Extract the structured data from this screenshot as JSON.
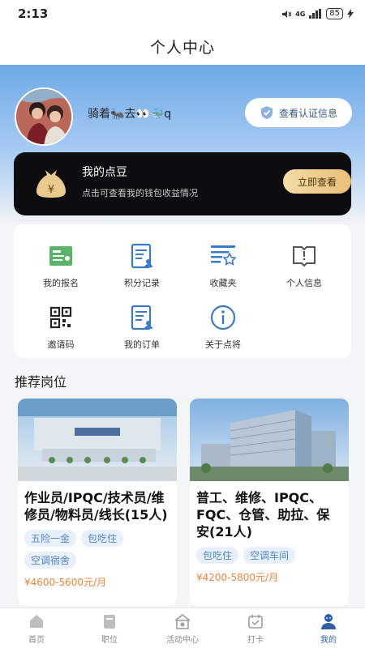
{
  "status": {
    "time": "2:13",
    "signal": "4G",
    "battery": "85"
  },
  "nav": {
    "title": "个人中心"
  },
  "profile": {
    "username": "骑着🐜去👀🐳q",
    "verify_label": "查看认证信息"
  },
  "coin_card": {
    "title": "我的点豆",
    "subtitle": "点击可查看我的钱包收益情况",
    "button": "立即查看"
  },
  "menu": [
    {
      "label": "我的报名",
      "icon": "signup-icon"
    },
    {
      "label": "积分记录",
      "icon": "points-record-icon"
    },
    {
      "label": "收藏夹",
      "icon": "favorites-icon"
    },
    {
      "label": "个人信息",
      "icon": "personal-info-icon"
    },
    {
      "label": "邀请码",
      "icon": "qrcode-icon"
    },
    {
      "label": "我的订单",
      "icon": "orders-icon"
    },
    {
      "label": "关于点将",
      "icon": "info-icon"
    }
  ],
  "recommend": {
    "title": "推荐岗位",
    "jobs": [
      {
        "title": "作业员/IPQC/技术员/维修员/物料员/线长(15人)",
        "tags": [
          "五险一金",
          "包吃住",
          "空调宿舍"
        ],
        "salary": "¥4600-5600元/月"
      },
      {
        "title": "普工、维修、IPQC、FQC、仓管、助拉、保安(21人)",
        "tags": [
          "包吃住",
          "空调车间"
        ],
        "salary": "¥4200-5800元/月"
      }
    ]
  },
  "tabs": [
    {
      "label": "首页",
      "icon": "home-icon"
    },
    {
      "label": "职位",
      "icon": "jobs-icon"
    },
    {
      "label": "活动中心",
      "icon": "activity-icon"
    },
    {
      "label": "打卡",
      "icon": "checkin-icon"
    },
    {
      "label": "我的",
      "icon": "profile-icon",
      "active": true
    }
  ],
  "colors": {
    "accent": "#2e5fa8",
    "tag_bg": "#e8f1fb",
    "tag_text": "#4f86c6",
    "salary": "#f0833a",
    "gold": "#e8bf79"
  }
}
